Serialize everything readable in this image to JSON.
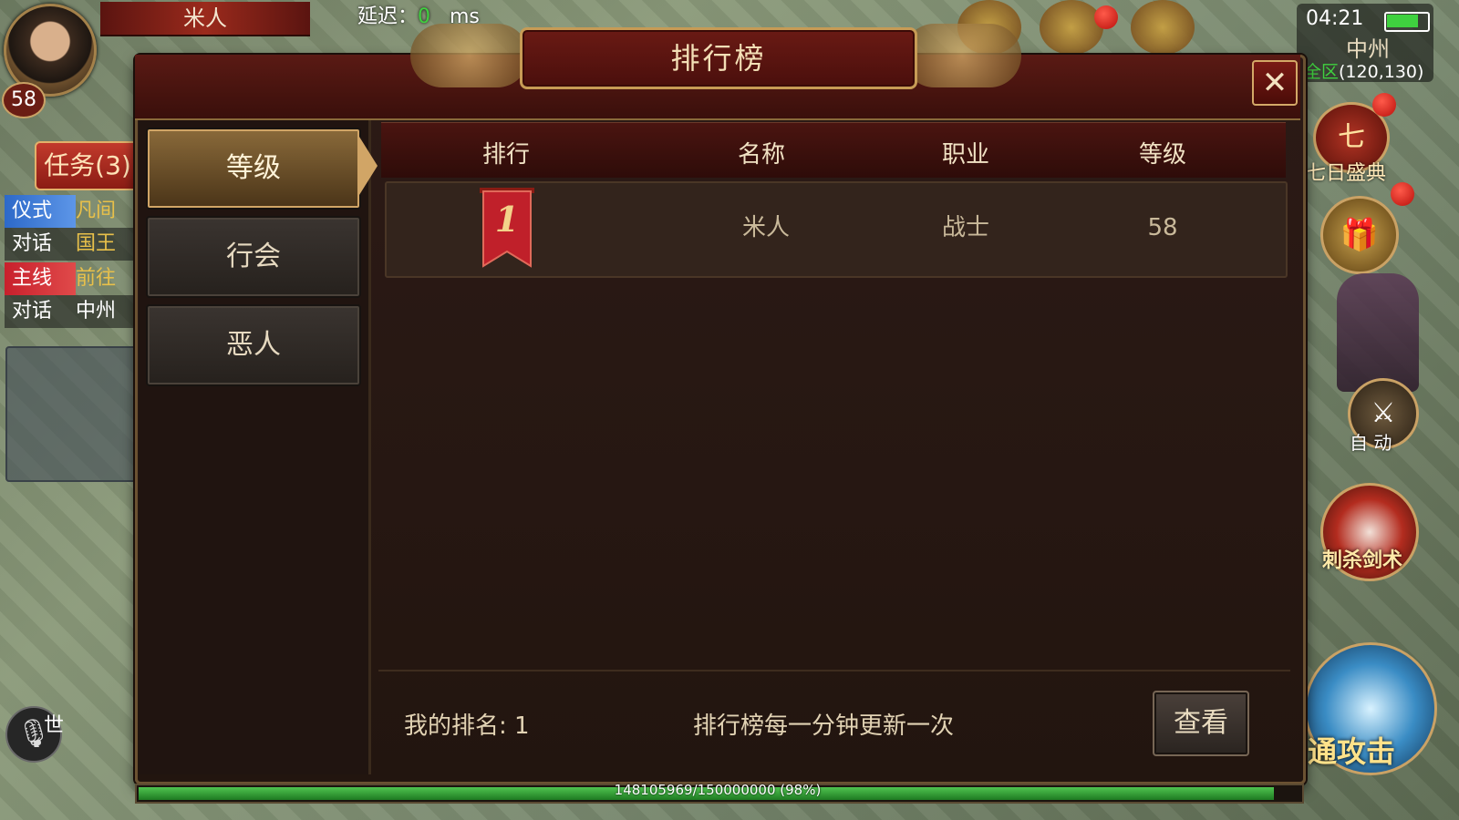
{
  "hud": {
    "player_name": "米人",
    "player_level": "58",
    "latency_label": "延迟：",
    "latency_value": "0",
    "latency_unit": "ms",
    "quest_button": "任务(3)",
    "quests": [
      {
        "tag": "仪式",
        "text": "凡间"
      },
      {
        "tag": "对话",
        "text": "国王"
      },
      {
        "tag": "主线",
        "text": "前往"
      },
      {
        "tag": "对话",
        "text": "中州"
      }
    ],
    "world_channel": "世",
    "mic_icon": "microphone-icon"
  },
  "status": {
    "clock": "04:21",
    "battery_level": 0.85,
    "zone": "中州",
    "coords_prefix": "全区",
    "coords": "(120,130)"
  },
  "side_buttons": {
    "seven_day_icon": "七",
    "seven_day_label": "七日盛典",
    "auto_icon": "⚔",
    "auto_label": "自 动",
    "skill1_label": "刺杀剑术",
    "skill2_label": "通攻击"
  },
  "panel": {
    "title": "排行榜",
    "close_icon": "✕",
    "tabs": [
      "等级",
      "行会",
      "恶人"
    ],
    "active_tab": 0,
    "columns": [
      "排行",
      "名称",
      "职业",
      "等级"
    ],
    "rows": [
      {
        "rank": "1",
        "name": "米人",
        "class": "战士",
        "level": "58"
      }
    ],
    "my_rank_label": "我的排名: 1",
    "update_notice": "排行榜每一分钟更新一次",
    "view_button": "查看"
  },
  "exp": {
    "text": "148105969/150000000 (98%)",
    "fraction": 0.98
  }
}
